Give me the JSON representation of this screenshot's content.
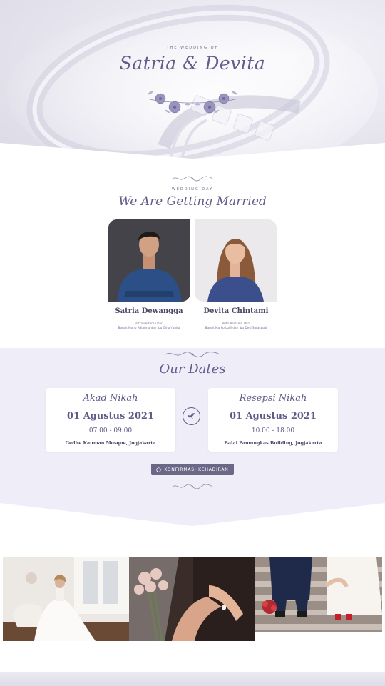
{
  "hero": {
    "kicker": "THE WEDDING OF",
    "title": "Satria & Devita"
  },
  "wedding_day": {
    "kicker": "WEDDING DAY",
    "title": "We Are Getting Married",
    "groom": {
      "name": "Satria Dewangga",
      "line1": "Putra Pertama Dari",
      "line2": "Bapak Mono Adiatma dan Ibu Gina Yunita"
    },
    "bride": {
      "name": "Devita Chintami",
      "line1": "Putri Pertama Dari",
      "line2": "Bapak Marko Luffi dan Ibu Desi Saraswati"
    }
  },
  "dates": {
    "title": "Our Dates",
    "akad": {
      "name": "Akad Nikah",
      "date": "01 Agustus 2021",
      "time": "07.00 - 09.00",
      "venue": "Gedhe Kauman Mosque, Jogjakarta"
    },
    "resepsi": {
      "name": "Resepsi Nikah",
      "date": "01 Agustus 2021",
      "time": "10.00 - 18.00",
      "venue": "Balai Pamungkas Building, Jogjakarta"
    },
    "rsvp_label": "KONFIRMASI KEHADIRAN",
    "badge_icon": "dove-icon"
  },
  "gallery": {
    "photos": [
      "bride-in-room-photo",
      "holding-hands-bouquet-photo",
      "couple-on-stairs-photo"
    ]
  },
  "colors": {
    "accent": "#625d8c",
    "section_bg": "#efeef8",
    "button_bg": "#6b6786"
  }
}
